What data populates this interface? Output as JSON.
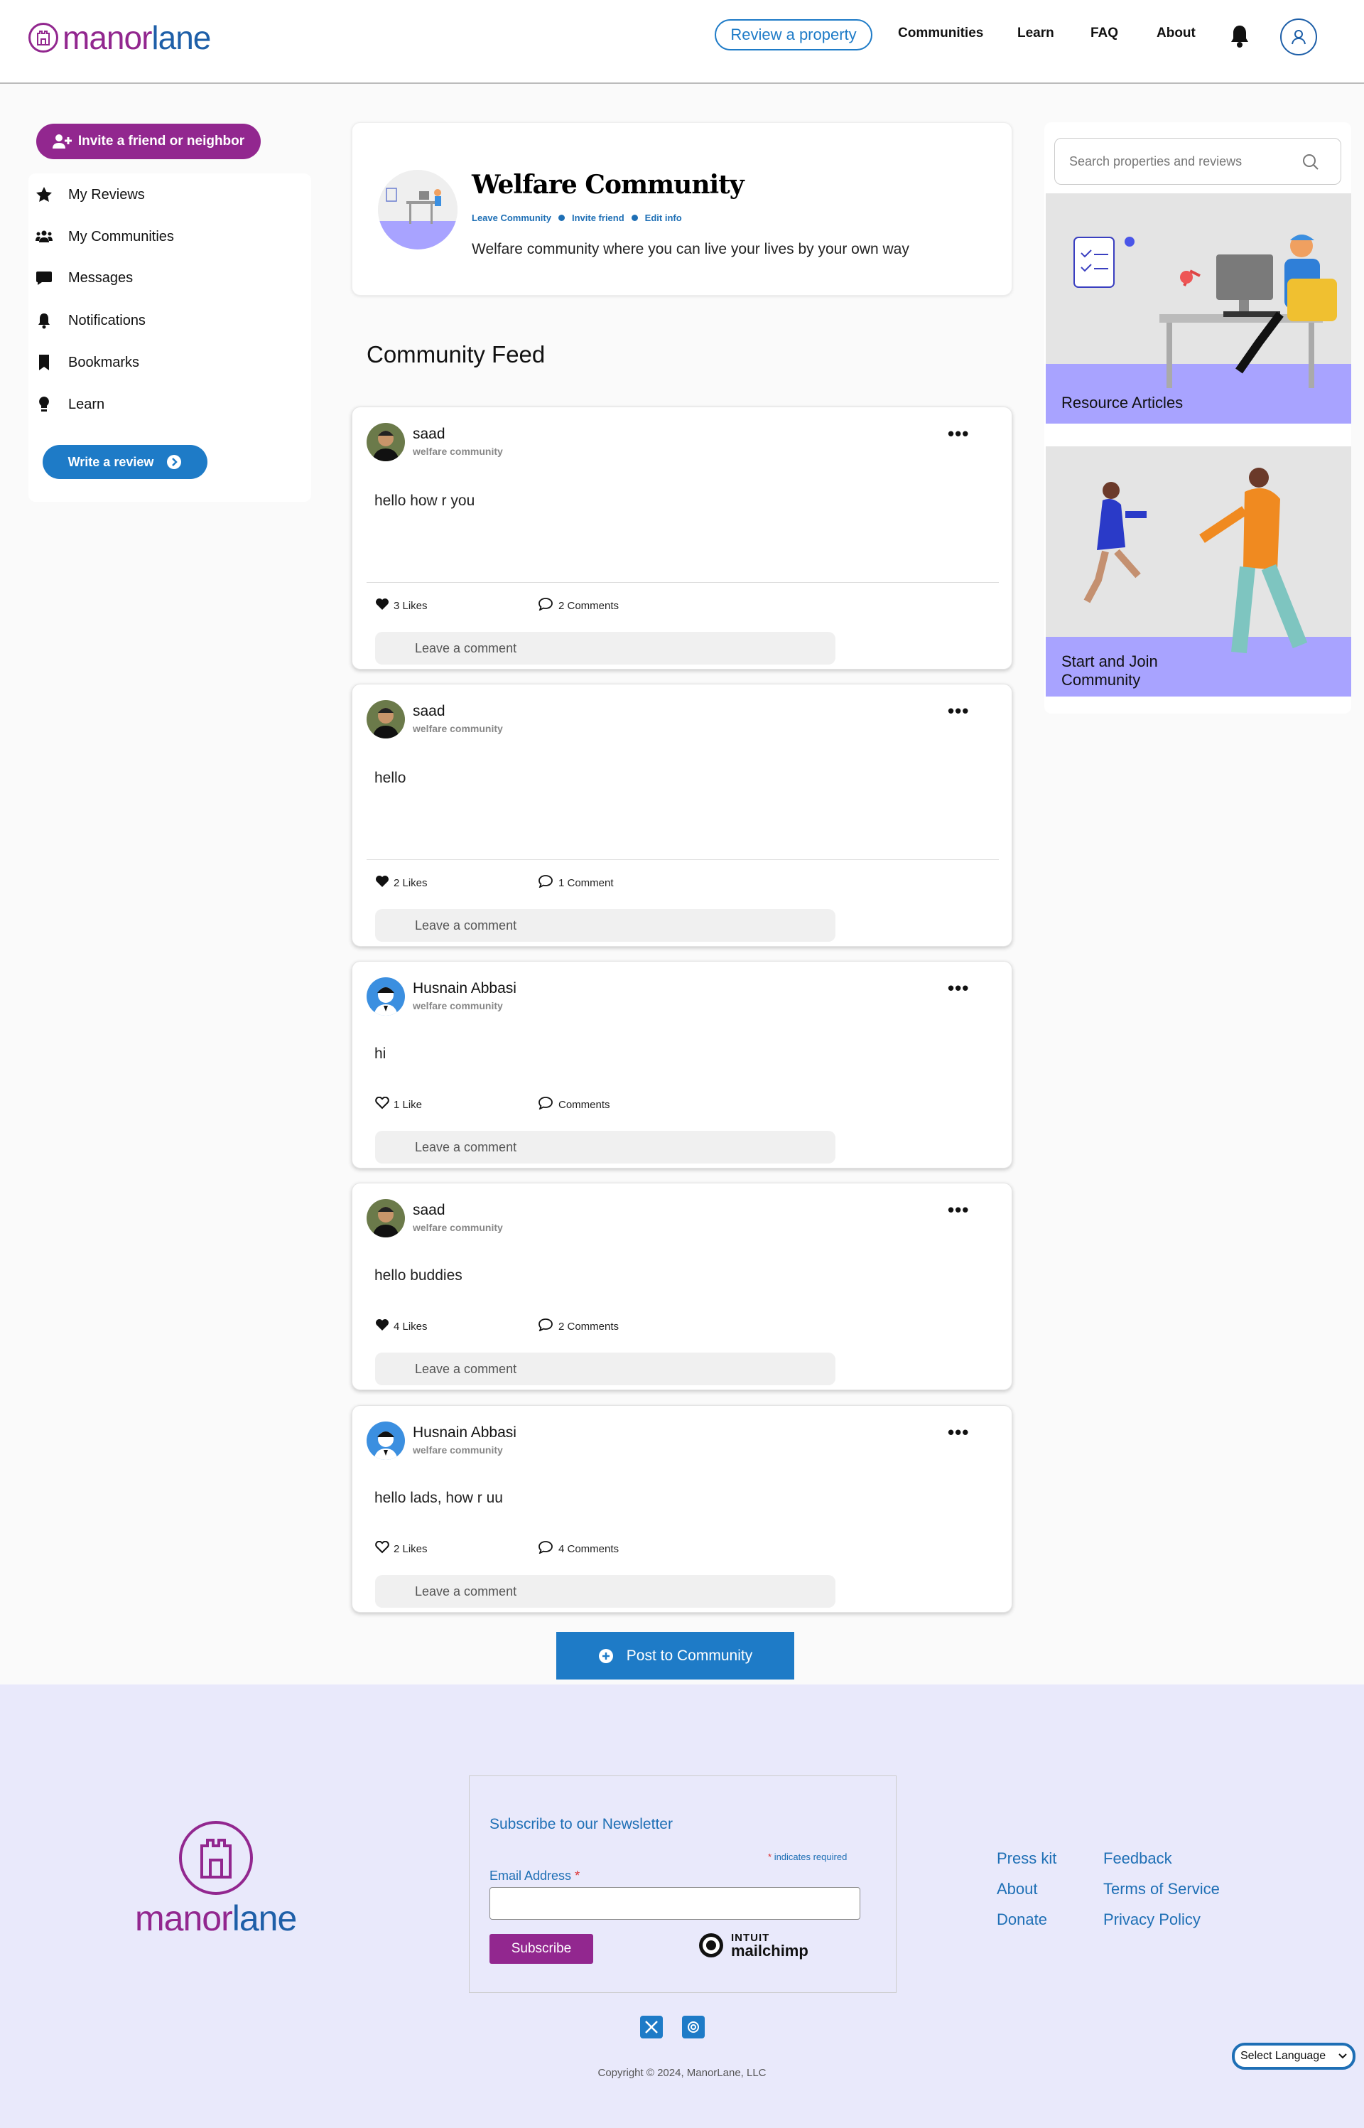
{
  "header": {
    "logo_part1": "manor",
    "logo_part2": "lane",
    "review_button": "Review a property",
    "nav": [
      "Communities",
      "Learn",
      "FAQ",
      "About"
    ]
  },
  "sidebar": {
    "invite_button": "Invite a friend or neighbor",
    "items": [
      {
        "label": "My Reviews",
        "icon": "star-icon"
      },
      {
        "label": "My Communities",
        "icon": "users-icon"
      },
      {
        "label": "Messages",
        "icon": "message-icon"
      },
      {
        "label": "Notifications",
        "icon": "bell-icon"
      },
      {
        "label": "Bookmarks",
        "icon": "bookmark-icon"
      },
      {
        "label": "Learn",
        "icon": "lightbulb-icon"
      }
    ],
    "write_review": "Write a review"
  },
  "community": {
    "title": "Welfare Community",
    "links": [
      "Leave Community",
      "Invite friend",
      "Edit info"
    ],
    "description": "Welfare community where you can live your lives by your own way"
  },
  "feed": {
    "title": "Community Feed",
    "posts": [
      {
        "author": "saad",
        "community": "welfare community",
        "text": "hello how r you",
        "likes": "3 Likes",
        "liked": true,
        "comments": "2 Comments",
        "comment_placeholder": "Leave a comment"
      },
      {
        "author": "saad",
        "community": "welfare community",
        "text": "hello",
        "likes": "2 Likes",
        "liked": true,
        "comments": "1 Comment",
        "comment_placeholder": "Leave a comment"
      },
      {
        "author": "Husnain Abbasi",
        "community": "welfare community",
        "text": "hi",
        "likes": "1 Like",
        "liked": false,
        "comments": "Comments",
        "comment_placeholder": "Leave a comment"
      },
      {
        "author": "saad",
        "community": "welfare community",
        "text": "hello buddies",
        "likes": "4 Likes",
        "liked": true,
        "comments": "2 Comments",
        "comment_placeholder": "Leave a comment"
      },
      {
        "author": "Husnain Abbasi",
        "community": "welfare community",
        "text": "hello lads, how r uu",
        "likes": "2 Likes",
        "liked": false,
        "comments": "4 Comments",
        "comment_placeholder": "Leave a comment"
      }
    ],
    "menu_glyph": "•••",
    "post_button": "Post to Community"
  },
  "right": {
    "search_placeholder": "Search properties and reviews",
    "card1_label": "Resource Articles",
    "card2_label_line1": "Start and Join",
    "card2_label_line2": "Community"
  },
  "footer": {
    "logo_part1": "manor",
    "logo_part2": "lane",
    "newsletter_title": "Subscribe to our Newsletter",
    "required_star": "*",
    "required_text": "indicates required",
    "email_label": "Email Address",
    "subscribe_button": "Subscribe",
    "mailchimp_line1": "INTUIT",
    "mailchimp_line2": "mailchimp",
    "links_col1": [
      "Press kit",
      "About",
      "Donate"
    ],
    "links_col2": [
      "Feedback",
      "Terms of Service",
      "Privacy Policy"
    ],
    "copyright": "Copyright © 2024, ManorLane, LLC",
    "language": "Select Language"
  },
  "colors": {
    "brand_purple": "#92278f",
    "brand_blue": "#1e7bc7",
    "footer_bg": "#e9e9fb"
  }
}
